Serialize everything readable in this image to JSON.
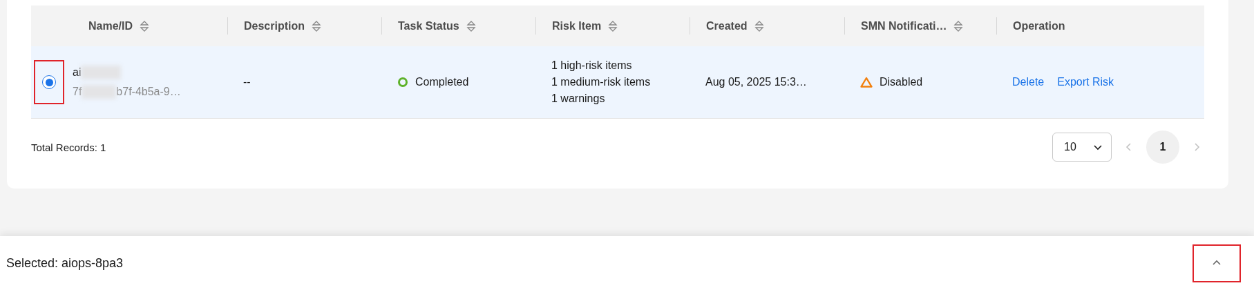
{
  "table": {
    "columns": [
      {
        "label": "Name/ID",
        "sortable": true
      },
      {
        "label": "Description",
        "sortable": true
      },
      {
        "label": "Task Status",
        "sortable": true
      },
      {
        "label": "Risk Item",
        "sortable": true
      },
      {
        "label": "Created",
        "sortable": true
      },
      {
        "label": "SMN Notificati…",
        "sortable": true
      },
      {
        "label": "Operation",
        "sortable": false
      }
    ],
    "rows": [
      {
        "selected": true,
        "highlighted": true,
        "name": "ai",
        "id": [
          "7f",
          "b7f-4b5a-9…"
        ],
        "description": "--",
        "status": {
          "label": "Completed",
          "kind": "success"
        },
        "risk_items": [
          "1 high-risk items",
          "1 medium-risk items",
          "1 warnings"
        ],
        "created": "Aug 05, 2025 15:3…",
        "notification": {
          "label": "Disabled",
          "kind": "warning"
        },
        "operations": [
          "Delete",
          "Export Risk"
        ]
      }
    ]
  },
  "pagination": {
    "total": "Total Records: 1",
    "page_size": "10",
    "prev_disabled": true,
    "next_disabled": true,
    "pages": [
      {
        "label": "1",
        "selected": true
      }
    ]
  },
  "selection_bar": {
    "text": "Selected: aiops-8pa3",
    "collapse_highlighted": true
  }
}
